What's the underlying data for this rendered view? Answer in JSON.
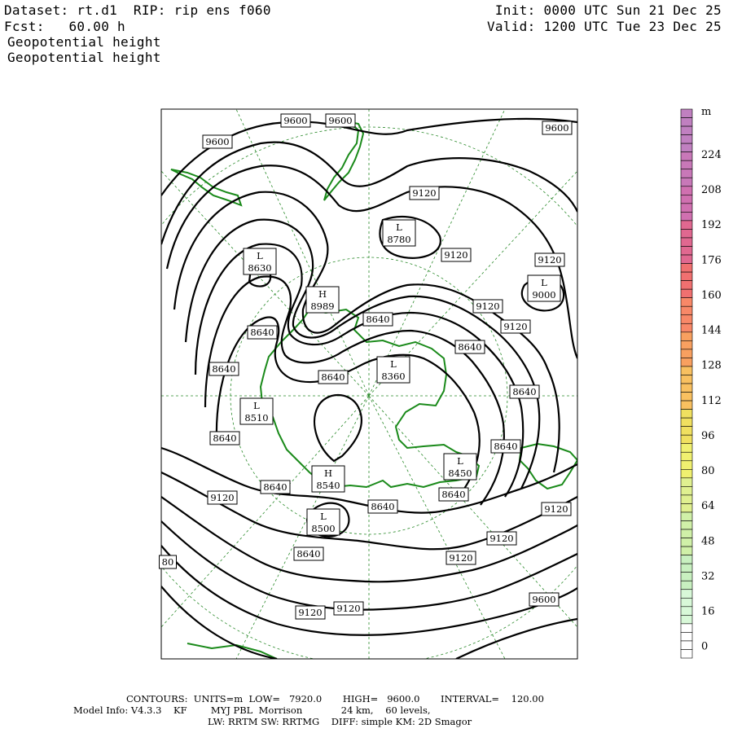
{
  "header": {
    "dataset_line": "Dataset: rt.d1  RIP: rip ens f060",
    "fcst_line": "Fcst:   60.00 h",
    "field1": "Geopotential height",
    "field2": "Geopotential height",
    "init_line": "Init: 0000 UTC Sun 21 Dec 25",
    "valid_line": "Valid: 1200 UTC Tue 23 Dec 25"
  },
  "colorbar": {
    "unit": "m",
    "labels": [
      "224",
      "208",
      "192",
      "176",
      "160",
      "144",
      "128",
      "112",
      "96",
      "80",
      "64",
      "48",
      "32",
      "16",
      "0"
    ],
    "colors_top_to_bottom": [
      "#c080c0",
      "#c878b8",
      "#d070b0",
      "#e06890",
      "#f07070",
      "#f88868",
      "#f8a060",
      "#f8c060",
      "#f0e060",
      "#f0f070",
      "#e0f090",
      "#d0f0a8",
      "#c8f0c0",
      "#d8f8d8",
      "#ffffff"
    ]
  },
  "contour_labels": [
    {
      "text": "9600"
    },
    {
      "text": "9600"
    },
    {
      "text": "9600"
    },
    {
      "text": "9600"
    },
    {
      "text": "9120"
    },
    {
      "text": "9120"
    },
    {
      "text": "9120"
    },
    {
      "text": "9120"
    },
    {
      "text": "9120"
    },
    {
      "text": "9120"
    },
    {
      "text": "9120"
    },
    {
      "text": "9120"
    },
    {
      "text": "9120"
    },
    {
      "text": "9120"
    },
    {
      "text": "9120"
    },
    {
      "text": "8640"
    },
    {
      "text": "8640"
    },
    {
      "text": "8640"
    },
    {
      "text": "8640"
    },
    {
      "text": "8640"
    },
    {
      "text": "8640"
    },
    {
      "text": "8640"
    },
    {
      "text": "8640"
    },
    {
      "text": "8640"
    },
    {
      "text": "8640"
    },
    {
      "text": "8640"
    },
    {
      "text": "8640"
    },
    {
      "text": "9600"
    },
    {
      "text": "80"
    }
  ],
  "centers": [
    {
      "kind": "L",
      "value": "8780"
    },
    {
      "kind": "L",
      "value": "8630"
    },
    {
      "kind": "H",
      "value": "8989"
    },
    {
      "kind": "L",
      "value": "9000"
    },
    {
      "kind": "L",
      "value": "8360"
    },
    {
      "kind": "L",
      "value": "8510"
    },
    {
      "kind": "L",
      "value": "8450"
    },
    {
      "kind": "H",
      "value": "8540"
    },
    {
      "kind": "L",
      "value": "8500"
    }
  ],
  "footer": {
    "line1": "CONTOURS:  UNITS=m  LOW=   7920.0       HIGH=   9600.0       INTERVAL=    120.00",
    "line2": "Model Info: V4.3.3    KF        MYJ PBL  Morrison             24 km,    60 levels,",
    "line3": "LW: RRTM SW: RRTMG    DIFF: simple KM: 2D Smagor"
  }
}
